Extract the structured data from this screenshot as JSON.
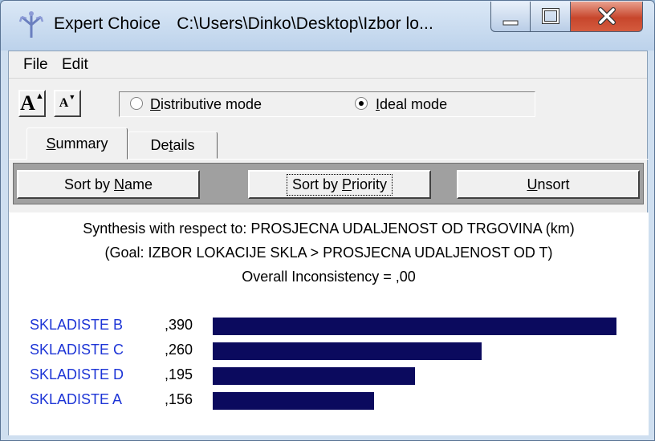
{
  "window": {
    "app_name": "Expert Choice",
    "path": "C:\\Users\\Dinko\\Desktop\\Izbor lo..."
  },
  "menu": {
    "items": [
      "File",
      "Edit"
    ]
  },
  "toolbar": {
    "increase_font": "A",
    "decrease_font": "A"
  },
  "modes": {
    "distributive": {
      "prefix": "",
      "accel": "D",
      "rest": "istributive mode",
      "selected": false
    },
    "ideal": {
      "prefix": "",
      "accel": "I",
      "rest": "deal mode",
      "selected": true
    }
  },
  "tabs": {
    "summary": {
      "accel": "S",
      "rest": "ummary"
    },
    "details": {
      "pre": "De",
      "accel": "t",
      "rest": "ails"
    }
  },
  "sort": {
    "by_name": {
      "pre": "Sort by ",
      "accel": "N",
      "rest": "ame"
    },
    "by_priority": {
      "pre": "Sort by ",
      "accel": "P",
      "rest": "riority"
    },
    "unsort": {
      "pre": "",
      "accel": "U",
      "rest": "nsort"
    }
  },
  "synthesis": {
    "line1": "Synthesis with respect to: PROSJECNA UDALJENOST OD TRGOVINA (km)",
    "line2": "(Goal: IZBOR LOKACIJE SKLA > PROSJECNA UDALJENOST OD T)",
    "line3": "Overall Inconsistency = ,00"
  },
  "chart_data": {
    "type": "bar",
    "categories": [
      "SKLADISTE B",
      "SKLADISTE C",
      "SKLADISTE D",
      "SKLADISTE A"
    ],
    "values": [
      0.39,
      0.26,
      0.195,
      0.156
    ],
    "labels": [
      ",390",
      ",260",
      ",195",
      ",156"
    ],
    "bar_color": "#0b0a5e",
    "name_color": "#1d35d6"
  }
}
